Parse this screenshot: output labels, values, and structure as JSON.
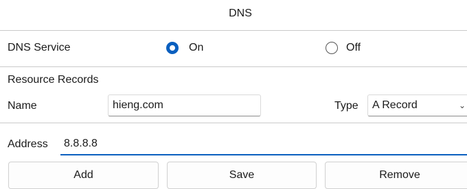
{
  "window": {
    "title": "DNS"
  },
  "dns_service": {
    "label": "DNS Service",
    "on_label": "On",
    "off_label": "Off",
    "selected": "On"
  },
  "resource_records": {
    "heading": "Resource Records",
    "name_label": "Name",
    "name_value": "hieng.com",
    "type_label": "Type",
    "type_value": "A Record",
    "address_label": "Address",
    "address_value": "8.8.8.8"
  },
  "buttons": {
    "add": "Add",
    "save": "Save",
    "remove": "Remove"
  },
  "colors": {
    "accent": "#0a5fbf"
  }
}
